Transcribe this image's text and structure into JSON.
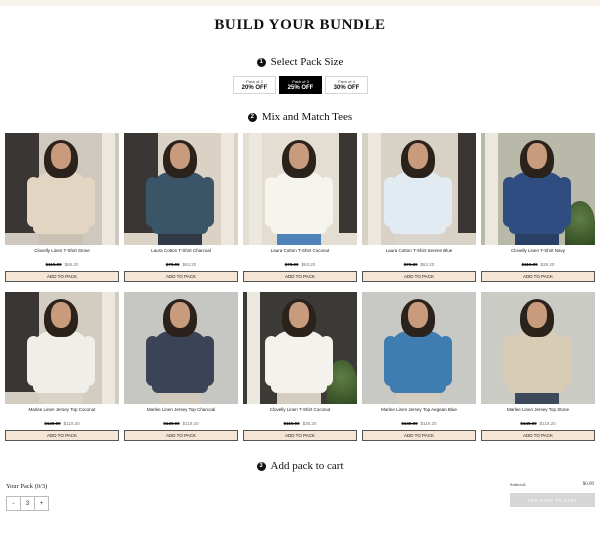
{
  "page": {
    "title": "BUILD YOUR BUNDLE"
  },
  "steps": [
    {
      "num": "1",
      "label": "Select Pack Size"
    },
    {
      "num": "2",
      "label": "Mix and Match Tees"
    },
    {
      "num": "3",
      "label": "Add pack to cart"
    }
  ],
  "packs": [
    {
      "label": "Pack of 2",
      "discount": "20% OFF",
      "selected": false
    },
    {
      "label": "Pack of 3",
      "discount": "25% OFF",
      "selected": true
    },
    {
      "label": "Pack of 4",
      "discount": "30% OFF",
      "selected": false
    }
  ],
  "products": [
    {
      "name": "Clovelly Linen T-Shirt Stone",
      "old_price": "$115.00",
      "price": "$65.20",
      "button": "ADD TO PACK",
      "shirt_color": "#e2d6c2",
      "bg_color": "#cfc8be",
      "scene": "window",
      "legs_color": "#c9c1b4"
    },
    {
      "name": "Laura Cotton T-Shirt Charcoal",
      "old_price": "$79.00",
      "price": "$63.20",
      "button": "ADD TO PACK",
      "shirt_color": "#3a5468",
      "bg_color": "#d9d2c5",
      "scene": "window",
      "legs_color": "#2f3a46"
    },
    {
      "name": "Laura Cotton T-Shirt Coconut",
      "old_price": "$79.00",
      "price": "$63.20",
      "button": "ADD TO PACK",
      "shirt_color": "#f6f4ef",
      "bg_color": "#e4ddd2",
      "scene": "column",
      "legs_color": "#4f82b8"
    },
    {
      "name": "Laura Cotton T-Shirt Serene Blue",
      "old_price": "$79.00",
      "price": "$63.20",
      "button": "ADD TO PACK",
      "shirt_color": "#e2ebf2",
      "bg_color": "#d8d2c6",
      "scene": "column",
      "legs_color": "#dad5cc"
    },
    {
      "name": "Clovelly Linen T-Shirt Navy",
      "old_price": "$115.00",
      "price": "$35.20",
      "button": "ADD TO PACK",
      "shirt_color": "#2f4d80",
      "bg_color": "#b9b9a9",
      "scene": "plant",
      "legs_color": "#2a3f66"
    },
    {
      "name": "Marlee Linen Jersey Top Coconut",
      "old_price": "$149.00",
      "price": "$119.20",
      "button": "ADD TO PACK",
      "shirt_color": "#efeee8",
      "bg_color": "#d3cdc1",
      "scene": "window",
      "legs_color": "#d9d3c8"
    },
    {
      "name": "Marlee Linen Jersey Top Charcoal",
      "old_price": "$149.00",
      "price": "$119.20",
      "button": "ADD TO PACK",
      "shirt_color": "#3b4356",
      "bg_color": "#c6c7c3",
      "scene": "plain",
      "legs_color": "#cfc8b8"
    },
    {
      "name": "Clovelly Linen T-Shirt Coconut",
      "old_price": "$115.00",
      "price": "$35.20",
      "button": "ADD TO PACK",
      "shirt_color": "#f4f2ec",
      "bg_color": "#3c3a36",
      "scene": "plant",
      "legs_color": "#d3ccbf"
    },
    {
      "name": "Marlee Linen Jersey Top Aegean Blue",
      "old_price": "$149.00",
      "price": "$119.20",
      "button": "ADD TO PACK",
      "shirt_color": "#3f7cb0",
      "bg_color": "#c8c9c4",
      "scene": "plain",
      "legs_color": "#d1cbc0"
    },
    {
      "name": "Marlee Linen Jersey Top Stone",
      "old_price": "$149.00",
      "price": "$119.20",
      "button": "ADD TO PACK",
      "shirt_color": "#d8cdb4",
      "bg_color": "#cbcbc6",
      "scene": "plain",
      "legs_color": "#3d4a5c"
    }
  ],
  "your_pack": {
    "label": "Your Pack",
    "count": "(0/3)"
  },
  "stepper": {
    "minus": "-",
    "value": "3",
    "plus": "+"
  },
  "subtotal": {
    "label": "Subtotal:",
    "value": "$0.00"
  },
  "cart_button": {
    "label": "ADD PACK TO CART"
  }
}
